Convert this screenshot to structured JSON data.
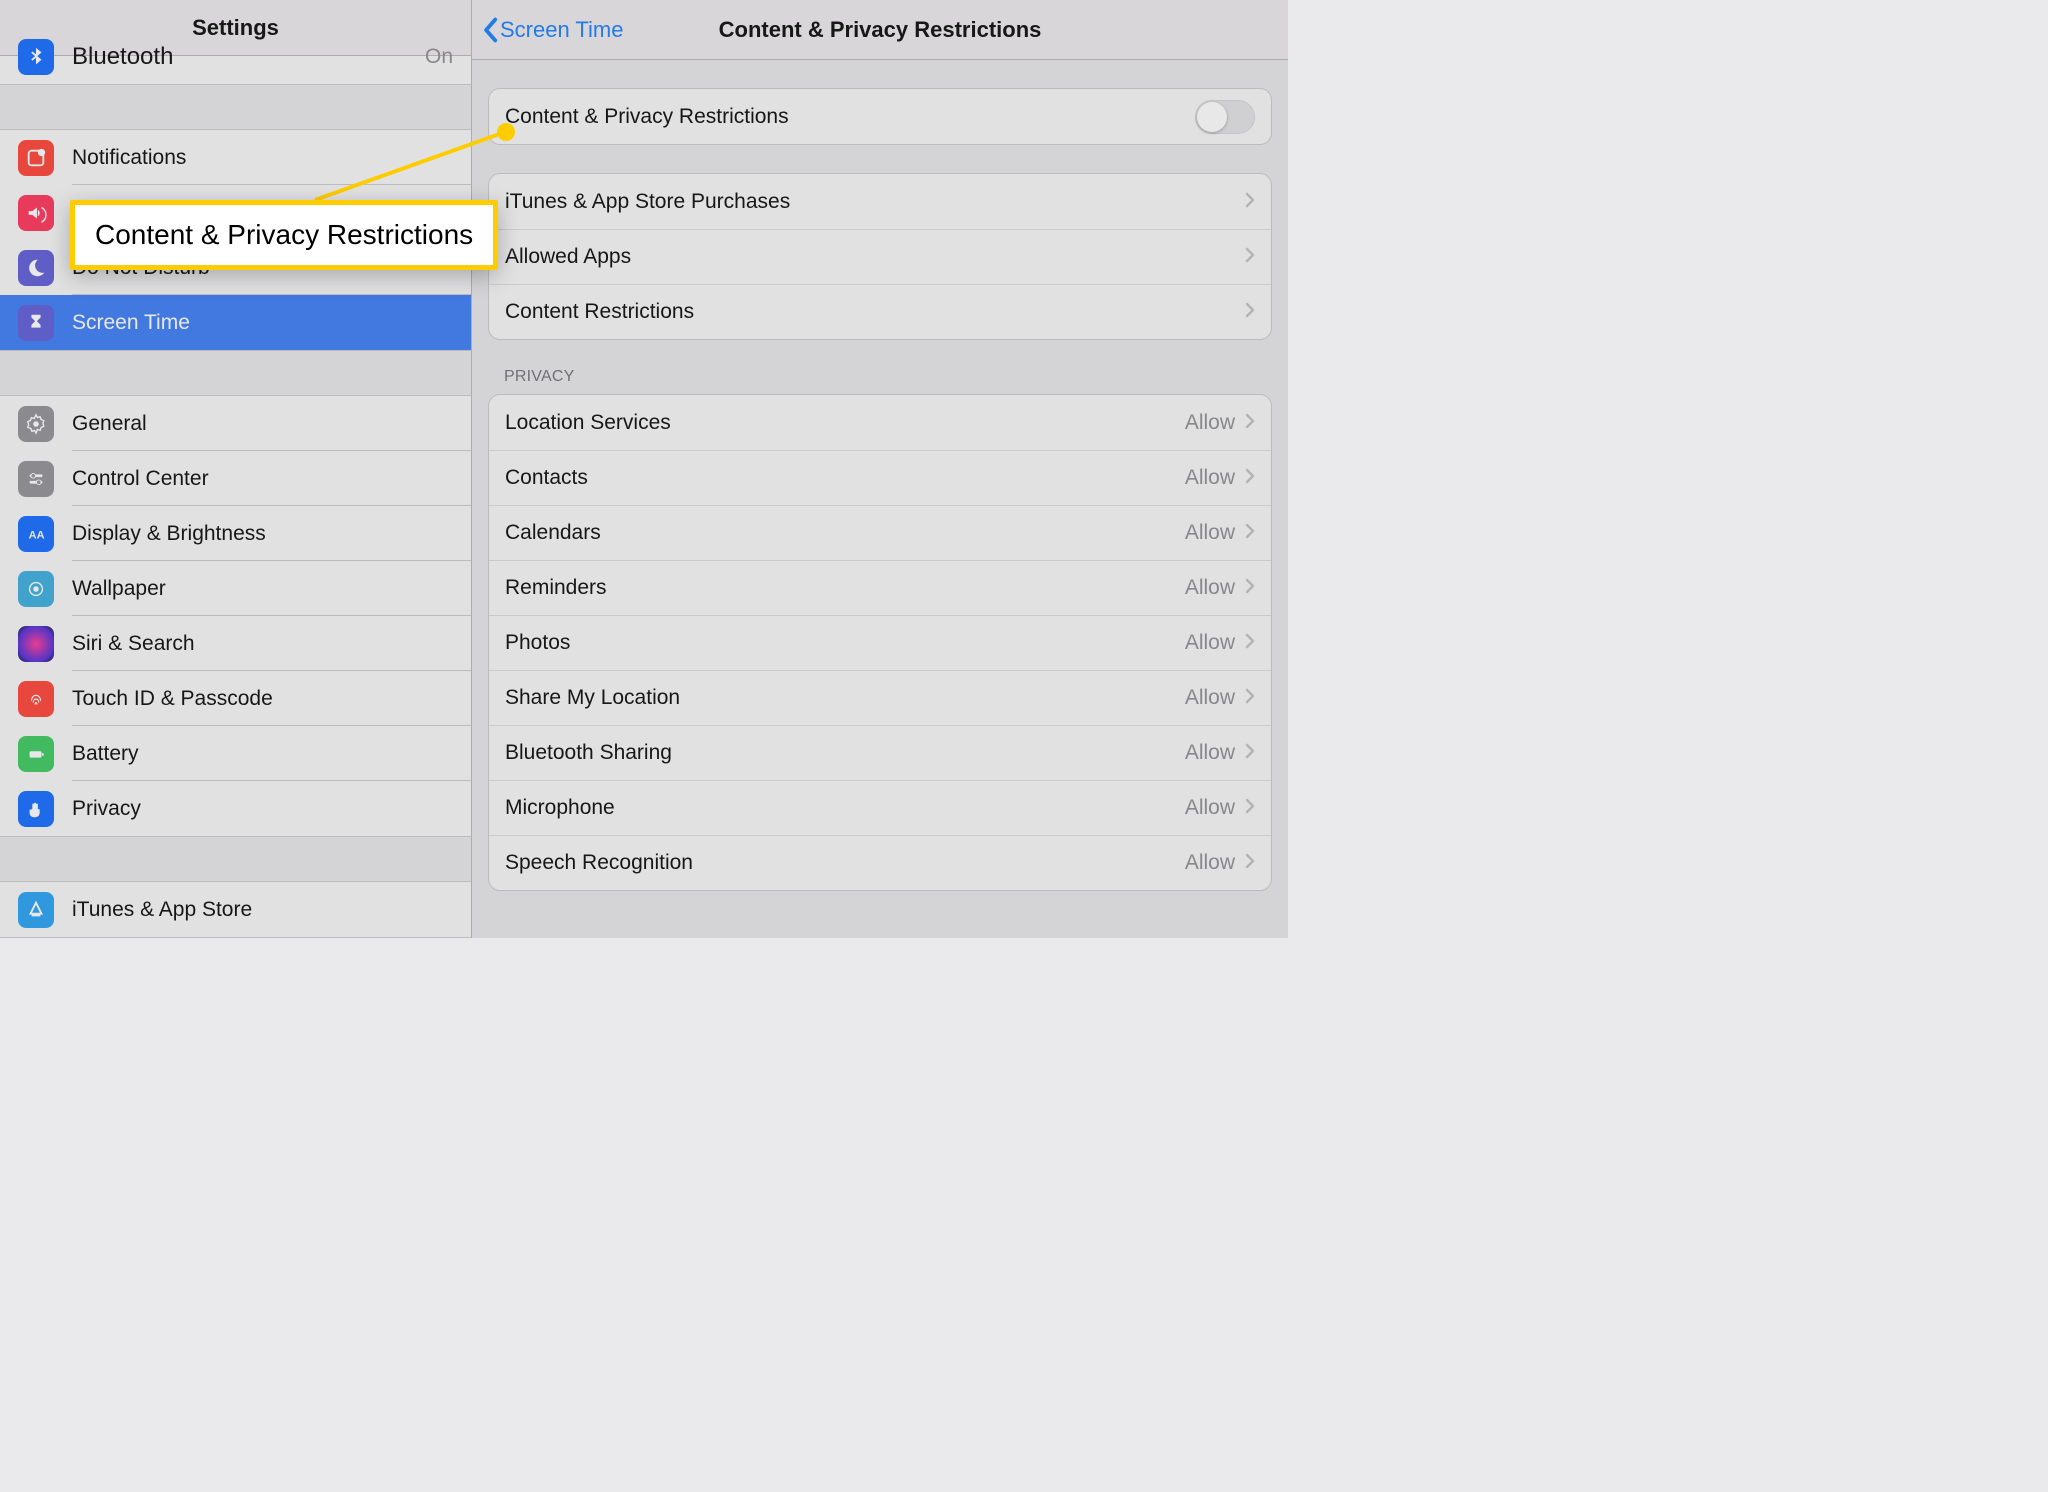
{
  "sidebar": {
    "title": "Settings",
    "bluetooth": {
      "label": "Bluetooth",
      "value": "On"
    },
    "items1": [
      {
        "label": "Notifications"
      },
      {
        "label": "Sounds"
      },
      {
        "label": "Do Not Disturb"
      },
      {
        "label": "Screen Time"
      }
    ],
    "items2": [
      {
        "label": "General"
      },
      {
        "label": "Control Center"
      },
      {
        "label": "Display & Brightness"
      },
      {
        "label": "Wallpaper"
      },
      {
        "label": "Siri & Search"
      },
      {
        "label": "Touch ID & Passcode"
      },
      {
        "label": "Battery"
      },
      {
        "label": "Privacy"
      }
    ],
    "items3": [
      {
        "label": "iTunes & App Store"
      }
    ]
  },
  "detail": {
    "back": "Screen Time",
    "title": "Content & Privacy Restrictions",
    "toggle_label": "Content & Privacy Restrictions",
    "group2": [
      {
        "label": "iTunes & App Store Purchases"
      },
      {
        "label": "Allowed Apps"
      },
      {
        "label": "Content Restrictions"
      }
    ],
    "privacy_header": "Privacy",
    "privacy_items": [
      {
        "label": "Location Services",
        "value": "Allow"
      },
      {
        "label": "Contacts",
        "value": "Allow"
      },
      {
        "label": "Calendars",
        "value": "Allow"
      },
      {
        "label": "Reminders",
        "value": "Allow"
      },
      {
        "label": "Photos",
        "value": "Allow"
      },
      {
        "label": "Share My Location",
        "value": "Allow"
      },
      {
        "label": "Bluetooth Sharing",
        "value": "Allow"
      },
      {
        "label": "Microphone",
        "value": "Allow"
      },
      {
        "label": "Speech Recognition",
        "value": "Allow"
      }
    ]
  },
  "callout": {
    "text": "Content & Privacy Restrictions"
  }
}
